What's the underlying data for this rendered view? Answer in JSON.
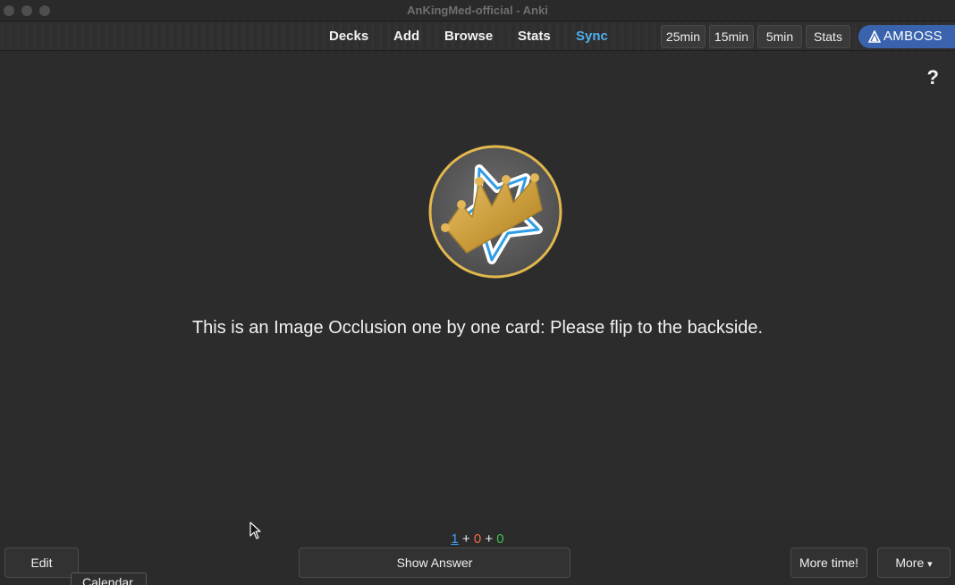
{
  "window": {
    "title": "AnKingMed-official - Anki"
  },
  "nav": {
    "decks": "Decks",
    "add": "Add",
    "browse": "Browse",
    "stats": "Stats",
    "sync": "Sync"
  },
  "timers": {
    "t25": "25min",
    "t15": "15min",
    "t5": "5min",
    "stats": "Stats"
  },
  "amboss": {
    "label": "AMBOSS"
  },
  "main": {
    "help": "?",
    "card_text": "This is an Image Occlusion one by one card: Please flip to the backside."
  },
  "counts": {
    "new": "1",
    "learn": "0",
    "review": "0",
    "plus": "+"
  },
  "bottom": {
    "edit": "Edit",
    "show_answer": "Show Answer",
    "more_time": "More time!",
    "more": "More",
    "more_arrow": "▾",
    "tooltip": "Calendar"
  },
  "colors": {
    "accent_sync": "#4fb0f0",
    "amboss_blue": "#3a63ad",
    "new": "#3fa0f5",
    "learn": "#f06a4a",
    "review": "#3cc04a"
  },
  "icons": [
    "help-icon",
    "anking-logo",
    "amboss-logo-icon",
    "mouse-cursor-icon",
    "dropdown-arrow-icon"
  ]
}
